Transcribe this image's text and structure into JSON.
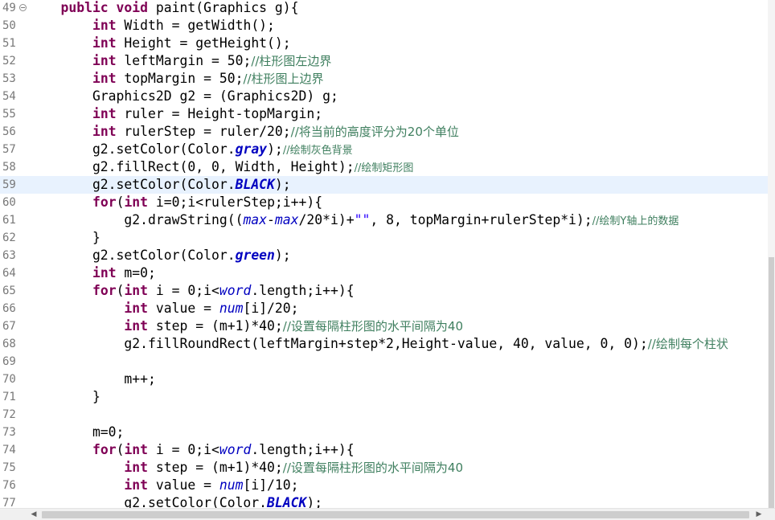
{
  "editor": {
    "line_numbers": [
      "49",
      "50",
      "51",
      "52",
      "53",
      "54",
      "55",
      "56",
      "57",
      "58",
      "59",
      "60",
      "61",
      "62",
      "63",
      "64",
      "65",
      "66",
      "67",
      "68",
      "69",
      "70",
      "71",
      "72",
      "73",
      "74",
      "75",
      "76",
      "77"
    ],
    "fold_marker": "−",
    "current_line": "59",
    "lines": [
      [
        [
          "k",
          "    public void "
        ],
        [
          "p",
          "paint(Graphics g){"
        ]
      ],
      [
        [
          "p",
          "        "
        ],
        [
          "k",
          "int"
        ],
        [
          "p",
          " Width = getWidth();"
        ]
      ],
      [
        [
          "p",
          "        "
        ],
        [
          "k",
          "int"
        ],
        [
          "p",
          " Height = getHeight();"
        ]
      ],
      [
        [
          "p",
          "        "
        ],
        [
          "k",
          "int"
        ],
        [
          "p",
          " leftMargin = 50;"
        ],
        [
          "c",
          "//柱形图左边界"
        ]
      ],
      [
        [
          "p",
          "        "
        ],
        [
          "k",
          "int"
        ],
        [
          "p",
          " topMargin = 50;"
        ],
        [
          "c",
          "//柱形图上边界"
        ]
      ],
      [
        [
          "p",
          "        Graphics2D g2 = (Graphics2D) g;"
        ]
      ],
      [
        [
          "p",
          "        "
        ],
        [
          "k",
          "int"
        ],
        [
          "p",
          " ruler = Height-topMargin;"
        ]
      ],
      [
        [
          "p",
          "        "
        ],
        [
          "k",
          "int"
        ],
        [
          "p",
          " rulerStep = ruler/20;"
        ],
        [
          "c",
          "//将当前的高度评分为20个单位"
        ]
      ],
      [
        [
          "p",
          "        g2.setColor(Color."
        ],
        [
          "fbi",
          "gray"
        ],
        [
          "p",
          ");"
        ],
        [
          "cs",
          "//绘制灰色背景"
        ]
      ],
      [
        [
          "p",
          "        g2.fillRect(0, 0, Width, Height);"
        ],
        [
          "cs",
          "//绘制矩形图"
        ]
      ],
      [
        [
          "p",
          "        g2.setColor(Color."
        ],
        [
          "fbi",
          "BLACK"
        ],
        [
          "p",
          ");"
        ]
      ],
      [
        [
          "p",
          "        "
        ],
        [
          "k",
          "for"
        ],
        [
          "p",
          "("
        ],
        [
          "k",
          "int"
        ],
        [
          "p",
          " i=0;i<rulerStep;i++){"
        ]
      ],
      [
        [
          "p",
          "            g2.drawString(("
        ],
        [
          "fi",
          "max"
        ],
        [
          "p",
          "-"
        ],
        [
          "fi",
          "max"
        ],
        [
          "p",
          "/20*i)+"
        ],
        [
          "st",
          "\"\""
        ],
        [
          "p",
          ", 8, topMargin+rulerStep*i);"
        ],
        [
          "cs",
          "//绘制Y轴上的数据"
        ]
      ],
      [
        [
          "p",
          "        }"
        ]
      ],
      [
        [
          "p",
          "        g2.setColor(Color."
        ],
        [
          "fbi",
          "green"
        ],
        [
          "p",
          ");"
        ]
      ],
      [
        [
          "p",
          "        "
        ],
        [
          "k",
          "int"
        ],
        [
          "p",
          " m=0;"
        ]
      ],
      [
        [
          "p",
          "        "
        ],
        [
          "k",
          "for"
        ],
        [
          "p",
          "("
        ],
        [
          "k",
          "int"
        ],
        [
          "p",
          " i = 0;i<"
        ],
        [
          "fi",
          "word"
        ],
        [
          "p",
          ".length;i++){"
        ]
      ],
      [
        [
          "p",
          "            "
        ],
        [
          "k",
          "int"
        ],
        [
          "p",
          " value = "
        ],
        [
          "fi",
          "num"
        ],
        [
          "p",
          "[i]/20;"
        ]
      ],
      [
        [
          "p",
          "            "
        ],
        [
          "k",
          "int"
        ],
        [
          "p",
          " step = (m+1)*40;"
        ],
        [
          "c",
          "//设置每隔柱形图的水平间隔为40"
        ]
      ],
      [
        [
          "p",
          "            g2.fillRoundRect(leftMargin+step*2,Height-value, 40, value, 0, 0);"
        ],
        [
          "c",
          "//绘制每个柱状"
        ]
      ],
      [
        [
          "p",
          ""
        ]
      ],
      [
        [
          "p",
          "            m++;"
        ]
      ],
      [
        [
          "p",
          "        }"
        ]
      ],
      [
        [
          "p",
          ""
        ]
      ],
      [
        [
          "p",
          "        m=0;"
        ]
      ],
      [
        [
          "p",
          "        "
        ],
        [
          "k",
          "for"
        ],
        [
          "p",
          "("
        ],
        [
          "k",
          "int"
        ],
        [
          "p",
          " i = 0;i<"
        ],
        [
          "fi",
          "word"
        ],
        [
          "p",
          ".length;i++){"
        ]
      ],
      [
        [
          "p",
          "            "
        ],
        [
          "k",
          "int"
        ],
        [
          "p",
          " step = (m+1)*40;"
        ],
        [
          "c",
          "//设置每隔柱形图的水平间隔为40"
        ]
      ],
      [
        [
          "p",
          "            "
        ],
        [
          "k",
          "int"
        ],
        [
          "p",
          " value = "
        ],
        [
          "fi",
          "num"
        ],
        [
          "p",
          "[i]/10;"
        ]
      ],
      [
        [
          "p",
          "            g2.setColor(Color."
        ],
        [
          "fbi",
          "BLACK"
        ],
        [
          "p",
          ");"
        ]
      ]
    ]
  },
  "scrollbar": {
    "left_arrow": "◀",
    "right_arrow": "▶"
  }
}
